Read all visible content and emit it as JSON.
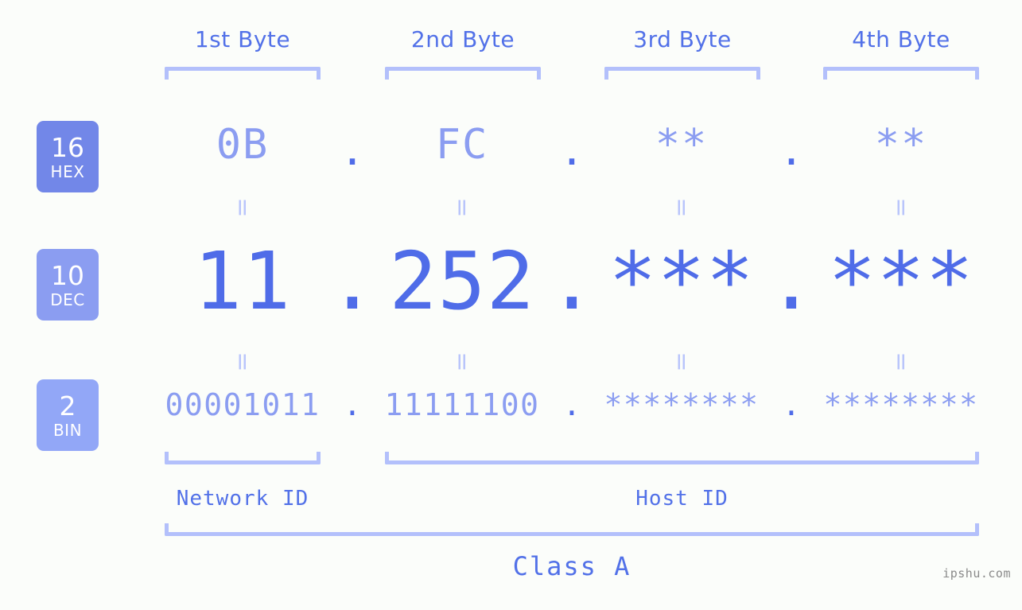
{
  "background_color": "#fbfdfa",
  "accent_color": "#4f6ce8",
  "accent_light_color": "#8b9df1",
  "bracket_color": "#b3c0fb",
  "headers": [
    {
      "label": "1st Byte"
    },
    {
      "label": "2nd Byte"
    },
    {
      "label": "3rd Byte"
    },
    {
      "label": "4th Byte"
    }
  ],
  "bases": [
    {
      "id": "hex",
      "number": "16",
      "name": "HEX",
      "color": "#7287e8"
    },
    {
      "id": "dec",
      "number": "10",
      "name": "DEC",
      "color": "#8b9df1"
    },
    {
      "id": "bin",
      "number": "2",
      "name": "BIN",
      "color": "#92a7f7"
    }
  ],
  "rows": {
    "hex": {
      "values": [
        "0B",
        "FC",
        "**",
        "**"
      ],
      "separator": "."
    },
    "dec": {
      "values": [
        "11",
        "252",
        "***",
        "***"
      ],
      "separator": "."
    },
    "bin": {
      "values": [
        "00001011",
        "11111100",
        "********",
        "********"
      ],
      "separator": "."
    }
  },
  "equals_glyph": "=",
  "segments": [
    {
      "label": "Network ID"
    },
    {
      "label": "Host ID"
    }
  ],
  "class_label": "Class A",
  "watermark": "ipshu.com"
}
